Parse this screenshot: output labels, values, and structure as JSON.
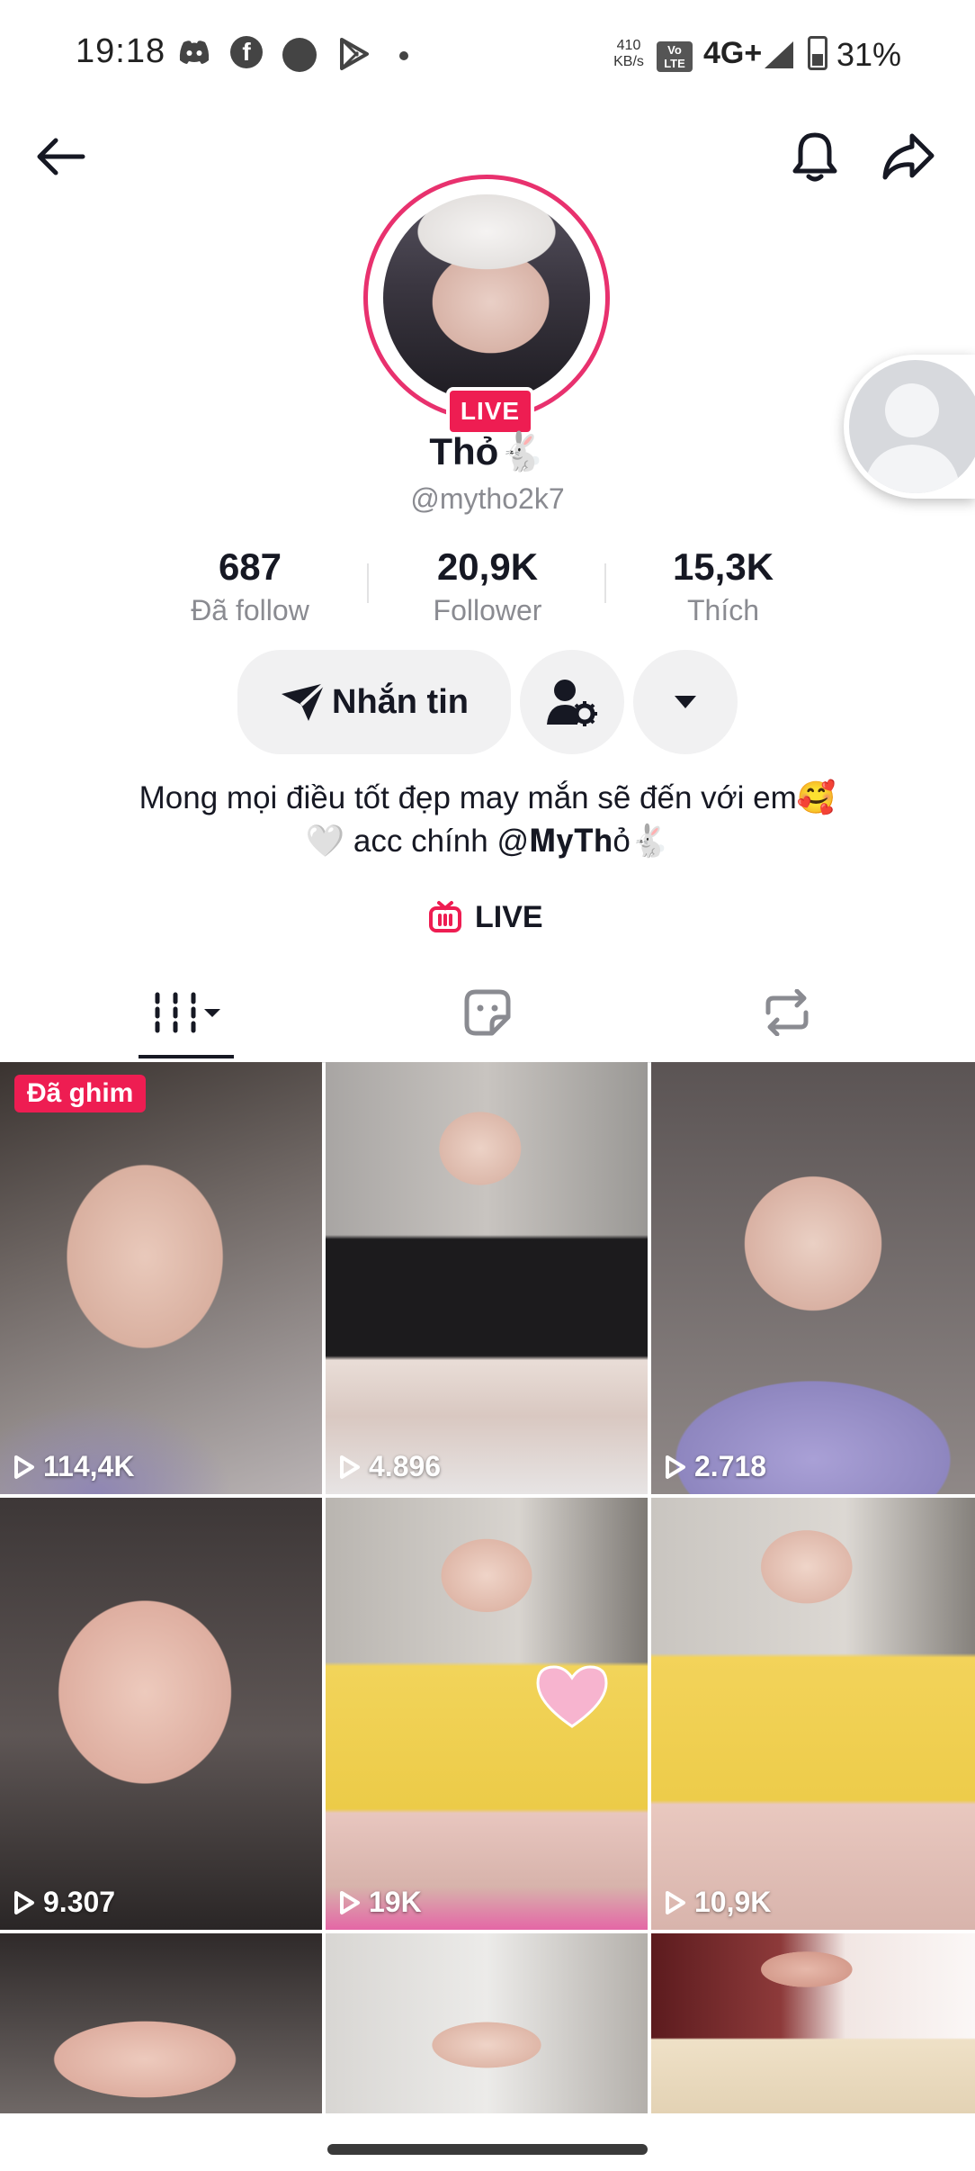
{
  "status_bar": {
    "time": "19:18",
    "net_speed_value": "410",
    "net_speed_unit": "KB/s",
    "volte": "Vo LTE",
    "network": "4G+",
    "battery": "31%"
  },
  "profile": {
    "live_badge": "LIVE",
    "display_name": "Thỏ🐇",
    "username": "@mytho2k7"
  },
  "stats": [
    {
      "value": "687",
      "label": "Đã follow"
    },
    {
      "value": "20,9K",
      "label": "Follower"
    },
    {
      "value": "15,3K",
      "label": "Thích"
    }
  ],
  "actions": {
    "message_label": "Nhắn tin"
  },
  "bio": {
    "line1": "Mong mọi điều tốt đẹp may mắn sẽ đến với em🥰",
    "line2": "🤍 acc chính @𝐌𝐲𝐓𝐡ỏ🐇"
  },
  "live_link": "LIVE",
  "videos": [
    {
      "views": "114,4K",
      "pinned_label": "Đã ghim"
    },
    {
      "views": "4.896"
    },
    {
      "views": "2.718"
    },
    {
      "views": "9.307"
    },
    {
      "views": "19K"
    },
    {
      "views": "10,9K"
    },
    {
      "views": ""
    },
    {
      "views": ""
    },
    {
      "views": ""
    }
  ],
  "colors": {
    "accent": "#ee1d52",
    "ring": "#e8316e",
    "text": "#161823",
    "muted": "#8a8b91"
  }
}
